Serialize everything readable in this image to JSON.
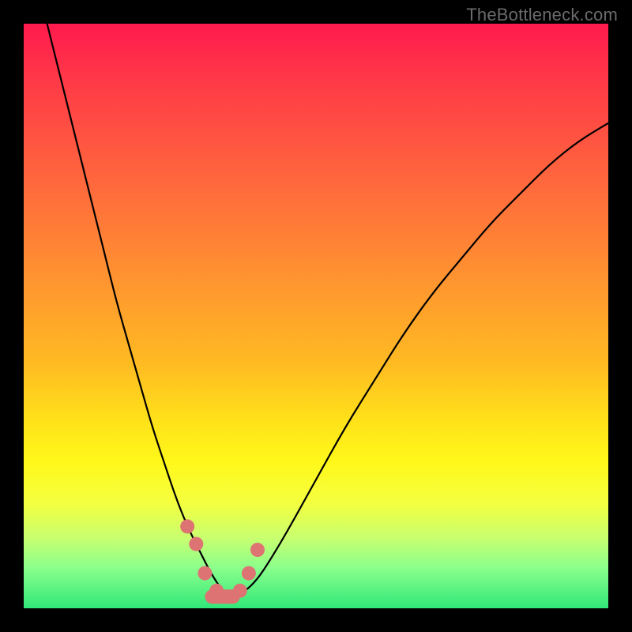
{
  "watermark": "TheBottleneck.com",
  "chart_data": {
    "type": "line",
    "title": "",
    "xlabel": "",
    "ylabel": "",
    "xlim": [
      0,
      100
    ],
    "ylim": [
      0,
      100
    ],
    "grid": false,
    "legend": false,
    "series": [
      {
        "name": "bottleneck-curve",
        "color": "#000000",
        "x": [
          4,
          6,
          8,
          10,
          12,
          14,
          16,
          18,
          20,
          22,
          24,
          26,
          28,
          30,
          32,
          34,
          35,
          36,
          38,
          40,
          42,
          45,
          50,
          55,
          60,
          65,
          70,
          75,
          80,
          85,
          90,
          95,
          100
        ],
        "y": [
          100,
          92,
          84,
          76,
          68,
          60,
          52,
          45,
          38,
          31,
          25,
          19,
          14,
          10,
          6,
          3,
          2,
          2,
          3,
          5,
          8,
          13,
          22,
          31,
          39,
          47,
          54,
          60,
          66,
          71,
          76,
          80,
          83
        ]
      },
      {
        "name": "near-minimum-markers",
        "color": "#de7373",
        "type": "scatter",
        "x": [
          28,
          29.5,
          31,
          33,
          35,
          37,
          38.5,
          40
        ],
        "y": [
          14,
          11,
          6,
          3,
          2,
          3,
          6,
          10
        ]
      }
    ],
    "annotations": []
  }
}
